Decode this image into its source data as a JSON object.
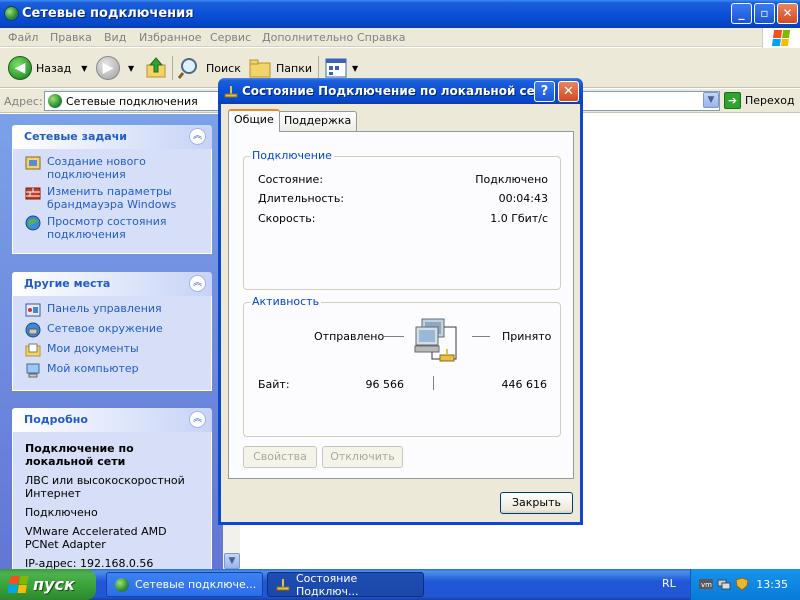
{
  "window": {
    "title": "Сетевые подключения",
    "controls": {
      "minimize": "_",
      "maximize": "▫",
      "close": "✕"
    }
  },
  "menu": [
    "Файл",
    "Правка",
    "Вид",
    "Избранное",
    "Сервис",
    "Дополнительно",
    "Справка"
  ],
  "toolbar": {
    "back_label": "Назад",
    "search_label": "Поиск",
    "folders_label": "Папки"
  },
  "address": {
    "label": "Адрес:",
    "value": "Сетевые подключения",
    "go_label": "Переход"
  },
  "taskpane": {
    "network_tasks": {
      "title": "Сетевые задачи",
      "items": [
        "Создание нового подключения",
        "Изменить параметры брандмауэра Windows",
        "Просмотр состояния подключения"
      ]
    },
    "other_places": {
      "title": "Другие места",
      "items": [
        "Панель управления",
        "Сетевое окружение",
        "Мои документы",
        "Мой компьютер"
      ]
    },
    "details": {
      "title": "Подробно",
      "name": "Подключение по локальной сети",
      "type": "ЛВС или высокоскоростной Интернет",
      "status": "Подключено",
      "adapter": "VMware Accelerated AMD PCNet Adapter",
      "ip": "IP-адрес: 192.168.0.56"
    }
  },
  "dialog": {
    "title": "Состояние Подключение по локальной сети",
    "help": "?",
    "close": "✕",
    "tabs": [
      "Общие",
      "Поддержка"
    ],
    "connection_group": {
      "title": "Подключение",
      "rows": [
        {
          "label": "Состояние:",
          "value": "Подключено"
        },
        {
          "label": "Длительность:",
          "value": "00:04:43"
        },
        {
          "label": "Скорость:",
          "value": "1.0 Гбит/с"
        }
      ]
    },
    "activity_group": {
      "title": "Активность",
      "sent_label": "Отправлено",
      "received_label": "Принято",
      "bytes_label": "Байт:",
      "bytes_sent": "96 566",
      "bytes_received": "446 616"
    },
    "buttons": {
      "properties": "Свойства",
      "disable": "Отключить",
      "close": "Закрыть"
    }
  },
  "taskbar": {
    "start_label": "пуск",
    "tasks": [
      "Сетевые подключе...",
      "Состояние Подключ..."
    ],
    "language": "RL",
    "clock": "13:35"
  },
  "colors": {
    "xp_blue": "#0a50d8",
    "link_blue": "#215dc6",
    "group_title_blue": "#0046d5",
    "start_green": "#37a137"
  }
}
